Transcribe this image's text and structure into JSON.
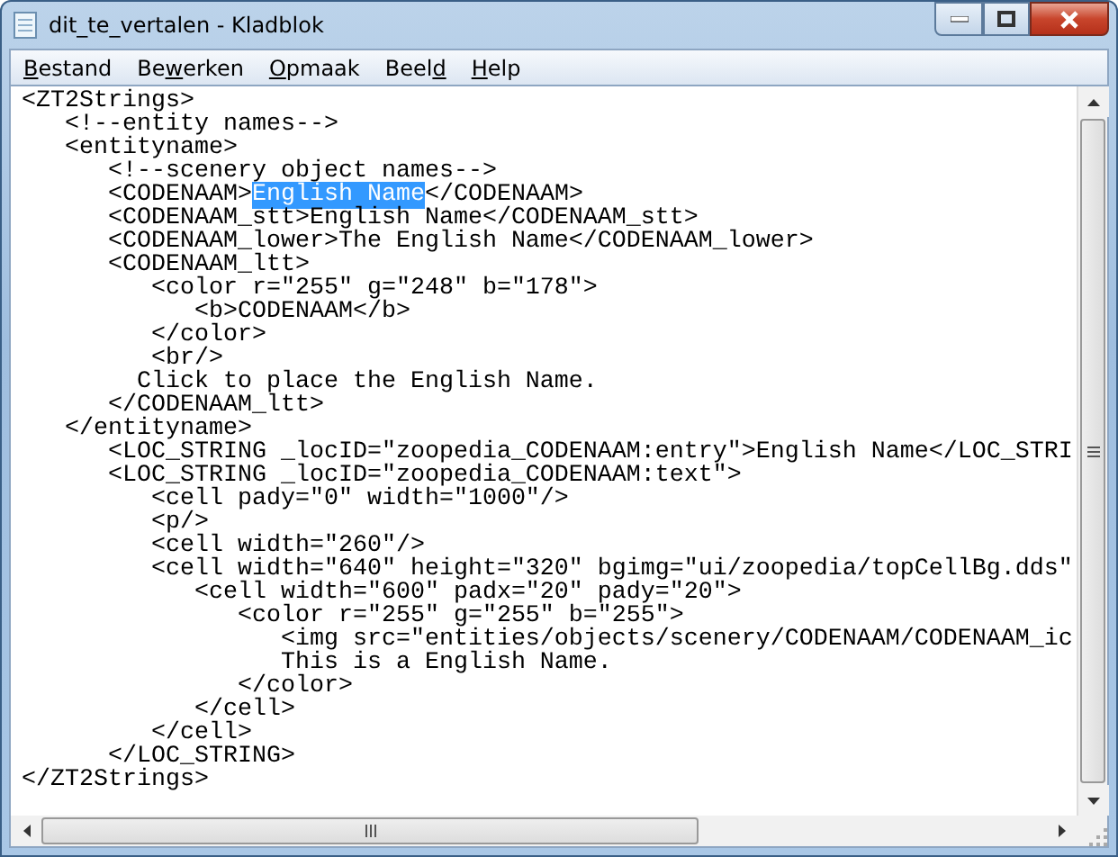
{
  "window": {
    "title": "dit_te_vertalen - Kladblok"
  },
  "menu": [
    {
      "access_key": "B",
      "after": "estand"
    },
    {
      "before": "Be",
      "access_key": "w",
      "after": "erken"
    },
    {
      "access_key": "O",
      "after": "pmaak"
    },
    {
      "before": "Beel",
      "access_key": "d"
    },
    {
      "access_key": "H",
      "after": "elp"
    }
  ],
  "lines": [
    {
      "segments": [
        {
          "text": "<ZT2Strings>",
          "selected": false
        }
      ]
    },
    {
      "segments": [
        {
          "text": "   <!--entity names-->",
          "selected": false
        }
      ]
    },
    {
      "segments": [
        {
          "text": "   <entityname>",
          "selected": false
        }
      ]
    },
    {
      "segments": [
        {
          "text": "      <!--scenery object names-->",
          "selected": false
        }
      ]
    },
    {
      "segments": [
        {
          "text": "      <CODENAAM>",
          "selected": false
        },
        {
          "text": "English Name",
          "selected": true
        },
        {
          "text": "</CODENAAM>",
          "selected": false
        }
      ]
    },
    {
      "segments": [
        {
          "text": "      <CODENAAM_stt>English Name</CODENAAM_stt>",
          "selected": false
        }
      ]
    },
    {
      "segments": [
        {
          "text": "      <CODENAAM_lower>The English Name</CODENAAM_lower>",
          "selected": false
        }
      ]
    },
    {
      "segments": [
        {
          "text": "      <CODENAAM_ltt>",
          "selected": false
        }
      ]
    },
    {
      "segments": [
        {
          "text": "         <color r=\"255\" g=\"248\" b=\"178\">",
          "selected": false
        }
      ]
    },
    {
      "segments": [
        {
          "text": "            <b>CODENAAM</b>",
          "selected": false
        }
      ]
    },
    {
      "segments": [
        {
          "text": "         </color>",
          "selected": false
        }
      ]
    },
    {
      "segments": [
        {
          "text": "         <br/>",
          "selected": false
        }
      ]
    },
    {
      "segments": [
        {
          "text": "        Click to place the English Name.",
          "selected": false
        }
      ]
    },
    {
      "segments": [
        {
          "text": "      </CODENAAM_ltt>",
          "selected": false
        }
      ]
    },
    {
      "segments": [
        {
          "text": "   </entityname>",
          "selected": false
        }
      ]
    },
    {
      "segments": [
        {
          "text": "      <LOC_STRING _locID=\"zoopedia_CODENAAM:entry\">English Name</LOC_STRI",
          "selected": false
        }
      ]
    },
    {
      "segments": [
        {
          "text": "      <LOC_STRING _locID=\"zoopedia_CODENAAM:text\">",
          "selected": false
        }
      ]
    },
    {
      "segments": [
        {
          "text": "         <cell pady=\"0\" width=\"1000\"/>",
          "selected": false
        }
      ]
    },
    {
      "segments": [
        {
          "text": "         <p/>",
          "selected": false
        }
      ]
    },
    {
      "segments": [
        {
          "text": "         <cell width=\"260\"/>",
          "selected": false
        }
      ]
    },
    {
      "segments": [
        {
          "text": "         <cell width=\"640\" height=\"320\" bgimg=\"ui/zoopedia/topCellBg.dds\"",
          "selected": false
        }
      ]
    },
    {
      "segments": [
        {
          "text": "            <cell width=\"600\" padx=\"20\" pady=\"20\">",
          "selected": false
        }
      ]
    },
    {
      "segments": [
        {
          "text": "               <color r=\"255\" g=\"255\" b=\"255\">",
          "selected": false
        }
      ]
    },
    {
      "segments": [
        {
          "text": "                  <img src=\"entities/objects/scenery/CODENAAM/CODENAAM_ic",
          "selected": false
        }
      ]
    },
    {
      "segments": [
        {
          "text": "                  This is a English Name.",
          "selected": false
        }
      ]
    },
    {
      "segments": [
        {
          "text": "               </color>",
          "selected": false
        }
      ]
    },
    {
      "segments": [
        {
          "text": "            </cell>",
          "selected": false
        }
      ]
    },
    {
      "segments": [
        {
          "text": "         </cell>",
          "selected": false
        }
      ]
    },
    {
      "segments": [
        {
          "text": "      </LOC_STRING>",
          "selected": false
        }
      ]
    },
    {
      "segments": [
        {
          "text": "</ZT2Strings>",
          "selected": false
        }
      ]
    }
  ]
}
